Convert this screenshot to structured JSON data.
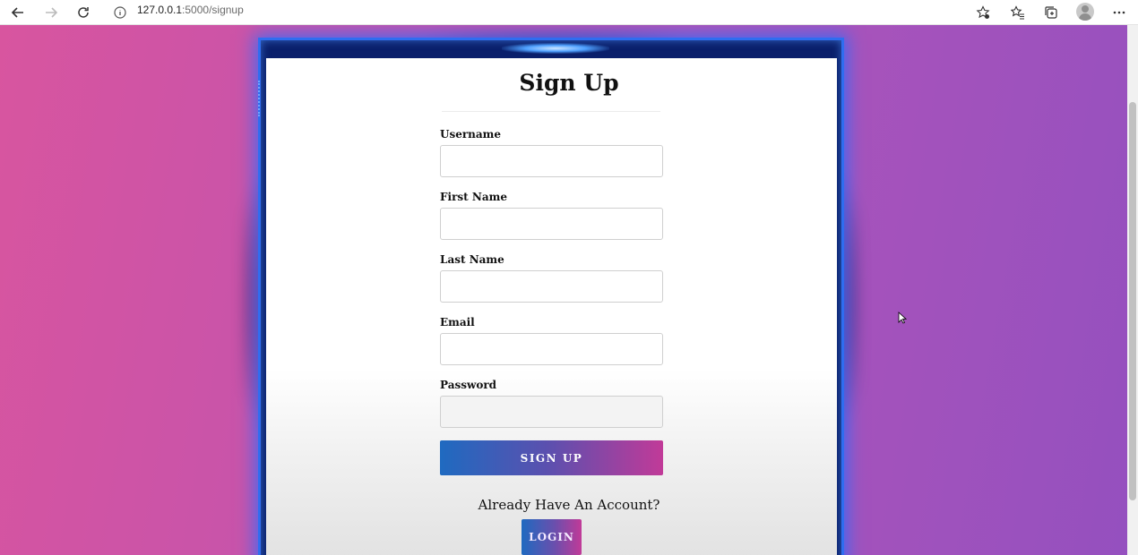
{
  "browser": {
    "url_host": "127.0.0.1",
    "url_path": ":5000/signup",
    "icons": [
      "back-arrow-icon",
      "forward-arrow-icon",
      "refresh-icon",
      "info-icon",
      "add-favorite-icon",
      "favorites-icon",
      "collections-icon",
      "profile-avatar-icon",
      "more-icon"
    ]
  },
  "form": {
    "title": "Sign Up",
    "fields": [
      {
        "label": "Username",
        "value": ""
      },
      {
        "label": "First Name",
        "value": ""
      },
      {
        "label": "Last Name",
        "value": ""
      },
      {
        "label": "Email",
        "value": ""
      },
      {
        "label": "Password",
        "value": ""
      }
    ],
    "signup_label": "SIGN UP",
    "already_text": "Already Have An Account?",
    "login_label": "LOGIN"
  },
  "colors": {
    "bg_left": "#d8559f",
    "bg_right": "#9450bf",
    "button_start": "#1f6ac0",
    "button_end": "#c13a98",
    "frame_accent": "#2f6df0"
  }
}
